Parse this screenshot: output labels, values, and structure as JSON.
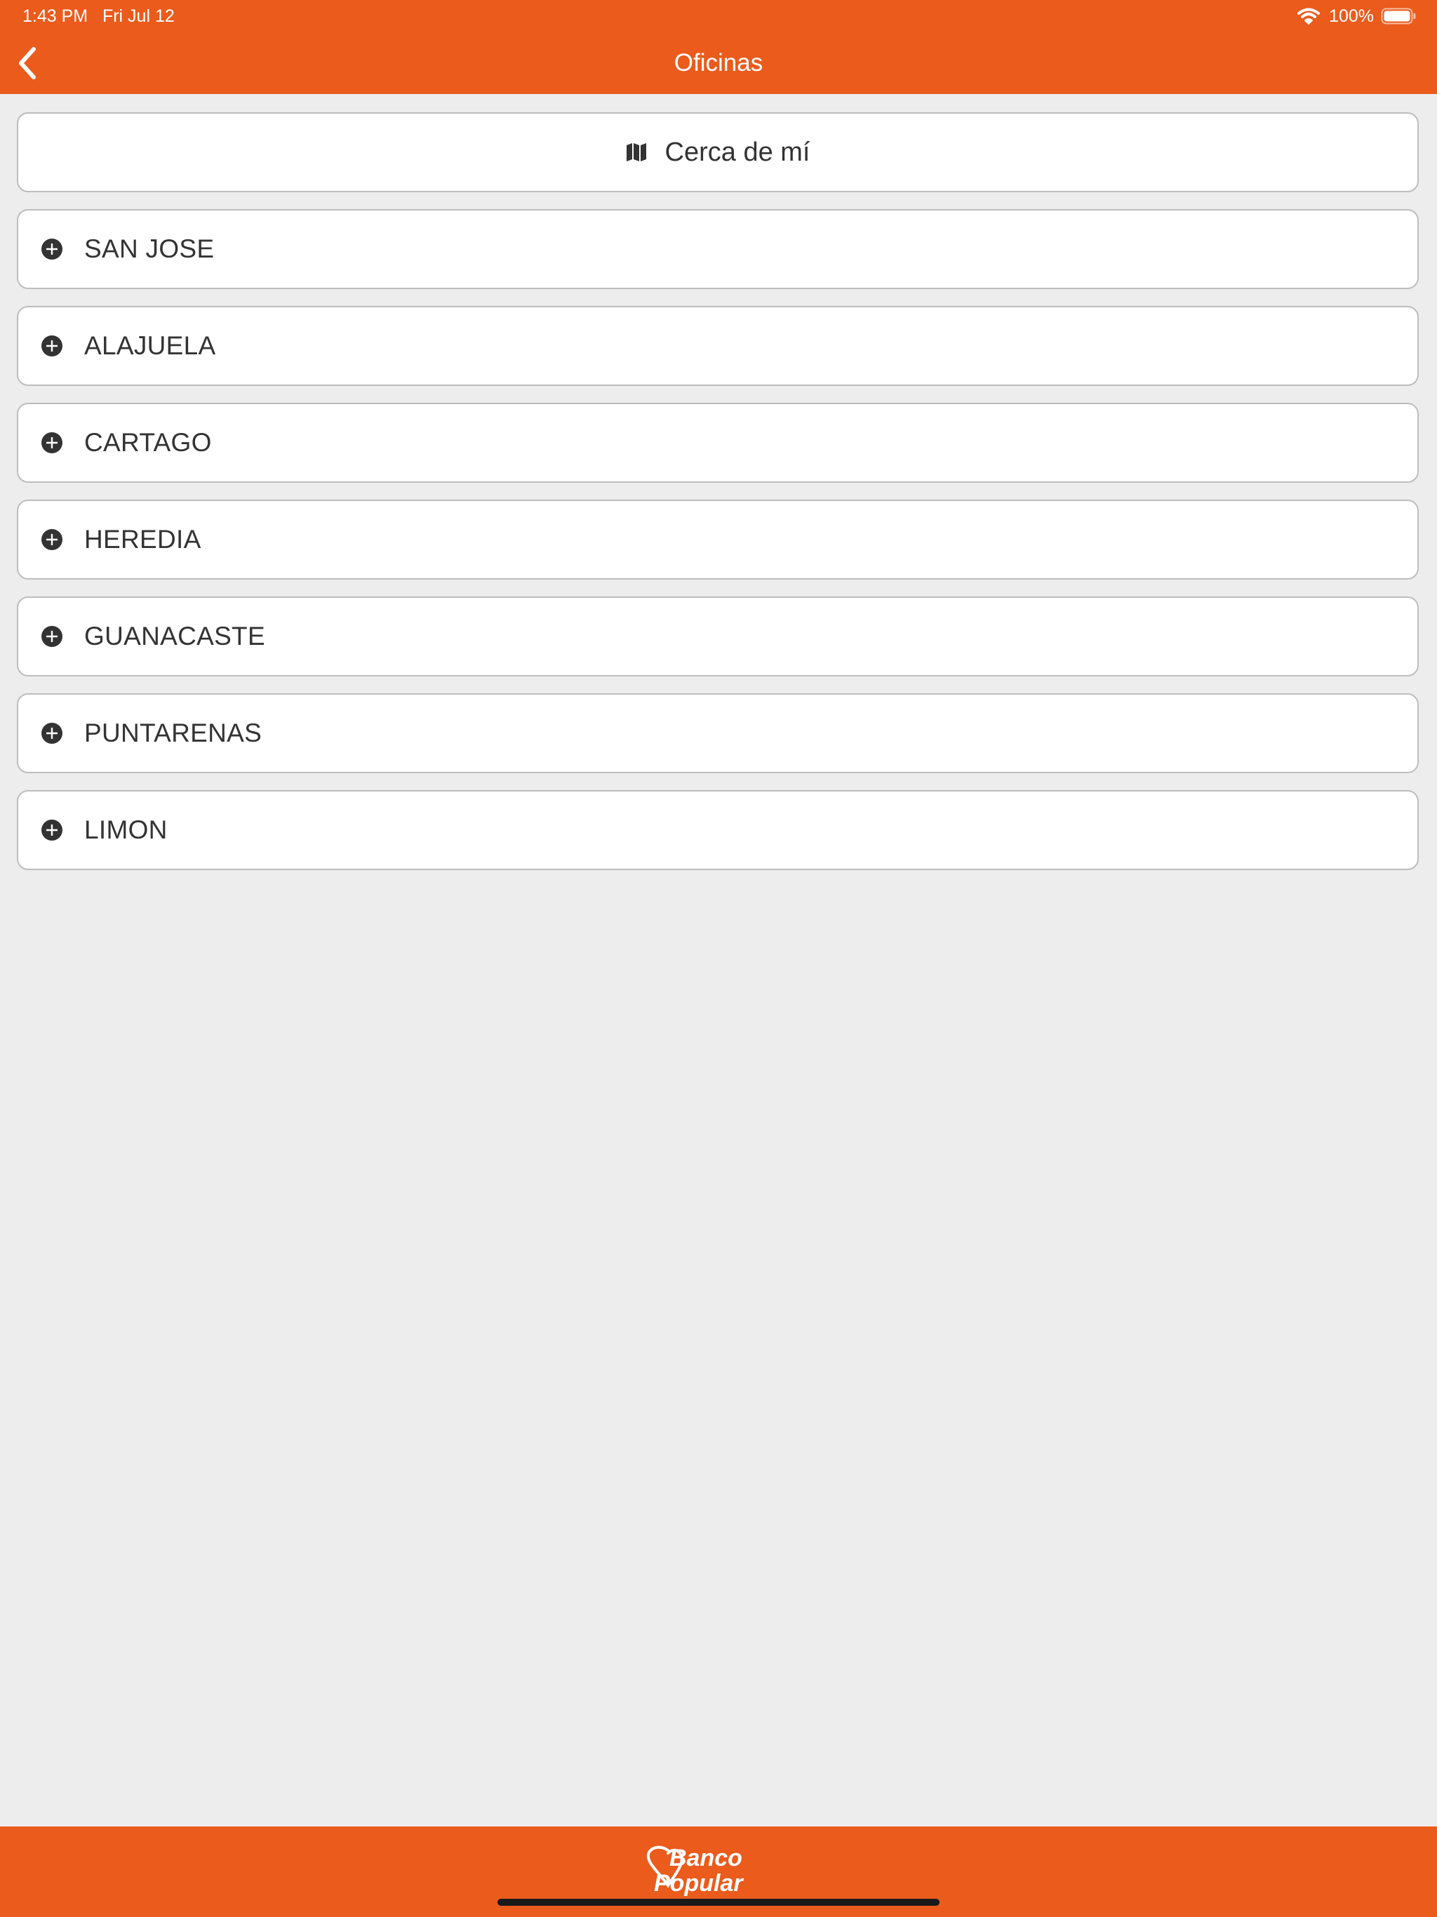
{
  "status_bar": {
    "time": "1:43 PM",
    "date": "Fri Jul 12",
    "battery": "100%",
    "icons": [
      "wifi-icon",
      "battery-icon"
    ]
  },
  "header": {
    "title": "Oficinas",
    "back_icon": "chevron-left-icon"
  },
  "nearby": {
    "label": "Cerca de mí",
    "icon": "map-icon"
  },
  "provinces": [
    {
      "label": "SAN JOSE"
    },
    {
      "label": "ALAJUELA"
    },
    {
      "label": "CARTAGO"
    },
    {
      "label": "HEREDIA"
    },
    {
      "label": "GUANACASTE"
    },
    {
      "label": "PUNTARENAS"
    },
    {
      "label": "LIMON"
    }
  ],
  "province_icon": "plus-circle-icon",
  "footer": {
    "logo": "Banco Popular"
  },
  "colors": {
    "brand": "#EA5B1C",
    "background": "#EDEDED",
    "row_background": "#FFFFFF",
    "row_border": "#BDBDBD",
    "text": "#333333"
  }
}
